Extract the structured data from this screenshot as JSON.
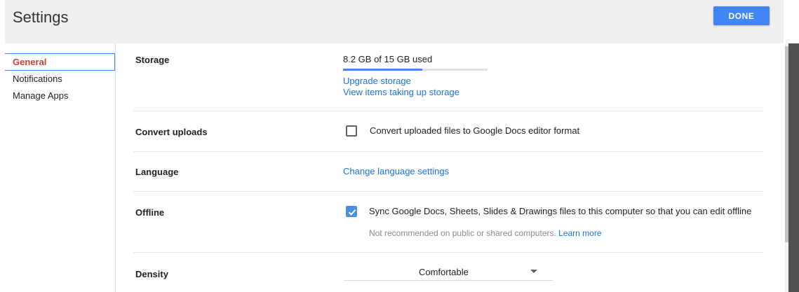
{
  "header": {
    "title": "Settings",
    "done_label": "DONE"
  },
  "sidebar": {
    "items": [
      {
        "label": "General",
        "active": true
      },
      {
        "label": "Notifications",
        "active": false
      },
      {
        "label": "Manage Apps",
        "active": false
      }
    ]
  },
  "storage": {
    "label": "Storage",
    "usage_text": "8.2 GB of 15 GB used",
    "used_fraction": 0.547,
    "upgrade_link": "Upgrade storage",
    "view_items_link": "View items taking up storage"
  },
  "convert_uploads": {
    "label": "Convert uploads",
    "option_text": "Convert uploaded files to Google Docs editor format",
    "checked": false
  },
  "language": {
    "label": "Language",
    "link": "Change language settings"
  },
  "offline": {
    "label": "Offline",
    "option_text": "Sync Google Docs, Sheets, Slides & Drawings files to this computer so that you can edit offline",
    "note": "Not recommended on public or shared computers.",
    "learn_more": "Learn more",
    "checked": true
  },
  "density": {
    "label": "Density",
    "value": "Comfortable"
  },
  "colors": {
    "accent": "#4285f4",
    "active_nav": "#d23f31",
    "link": "#1a73e8"
  }
}
